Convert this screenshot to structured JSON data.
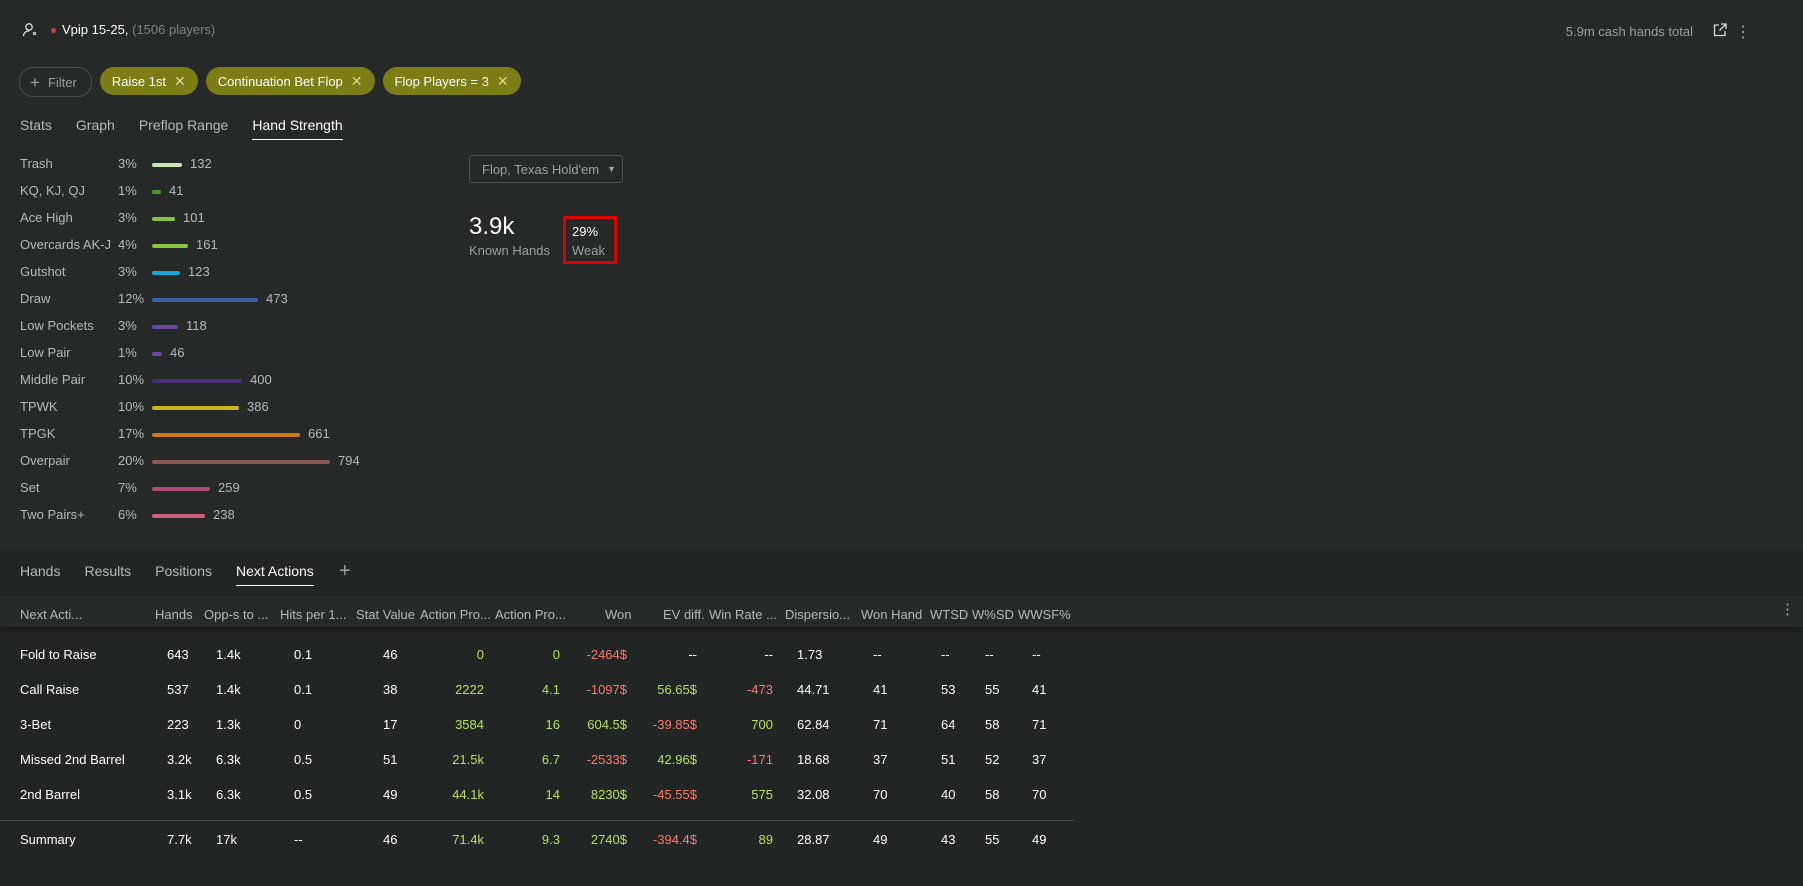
{
  "header": {
    "title": "Vpip 15-25,",
    "subtitle": "(1506 players)",
    "hands_total": "5.9m cash hands total"
  },
  "filters": {
    "add_label": "Filter",
    "chips": [
      "Raise 1st",
      "Continuation Bet Flop",
      "Flop Players = 3"
    ]
  },
  "tabs": [
    "Stats",
    "Graph",
    "Preflop Range",
    "Hand Strength"
  ],
  "active_tab": "Hand Strength",
  "hand_strength": [
    {
      "label": "Trash",
      "pct": "3%",
      "count": "132",
      "value": 132,
      "color": "#c8e6b4"
    },
    {
      "label": "KQ, KJ, QJ",
      "pct": "1%",
      "count": "41",
      "value": 41,
      "color": "#4b9a2a"
    },
    {
      "label": "Ace High",
      "pct": "3%",
      "count": "101",
      "value": 101,
      "color": "#8ac43c"
    },
    {
      "label": "Overcards AK-J",
      "pct": "4%",
      "count": "161",
      "value": 161,
      "color": "#8ac43c"
    },
    {
      "label": "Gutshot",
      "pct": "3%",
      "count": "123",
      "value": 123,
      "color": "#1aa7d8"
    },
    {
      "label": "Draw",
      "pct": "12%",
      "count": "473",
      "value": 473,
      "color": "#3c5ea8"
    },
    {
      "label": "Low Pockets",
      "pct": "3%",
      "count": "118",
      "value": 118,
      "color": "#6a4aa0"
    },
    {
      "label": "Low Pair",
      "pct": "1%",
      "count": "46",
      "value": 46,
      "color": "#6a4aa0"
    },
    {
      "label": "Middle Pair",
      "pct": "10%",
      "count": "400",
      "value": 400,
      "color": "#4a2f7a"
    },
    {
      "label": "TPWK",
      "pct": "10%",
      "count": "386",
      "value": 386,
      "color": "#c8b81e"
    },
    {
      "label": "TPGK",
      "pct": "17%",
      "count": "661",
      "value": 661,
      "color": "#d07a18"
    },
    {
      "label": "Overpair",
      "pct": "20%",
      "count": "794",
      "value": 794,
      "color": "#8a5a55"
    },
    {
      "label": "Set",
      "pct": "7%",
      "count": "259",
      "value": 259,
      "color": "#b04a78"
    },
    {
      "label": "Two Pairs+",
      "pct": "6%",
      "count": "238",
      "value": 238,
      "color": "#d0607a"
    }
  ],
  "street_select": "Flop, Texas Hold'em",
  "known_hands": {
    "value": "3.9k",
    "label": "Known Hands"
  },
  "weak": {
    "value": "29%",
    "label": "Weak"
  },
  "bottom_tabs": [
    "Hands",
    "Results",
    "Positions",
    "Next Actions"
  ],
  "bottom_active": "Next Actions",
  "table": {
    "headers": [
      "Next Acti...",
      "Hands",
      "Opp-s to ...",
      "Hits per 1...",
      "Stat Value",
      "Action Pro...",
      "Action Pro...",
      "Won",
      "EV diff.",
      "Win Rate ...",
      "Dispersio...",
      "Won Hand",
      "WTSD",
      "W%SD",
      "WWSF%"
    ],
    "rows": [
      [
        "Fold to Raise",
        "643",
        "1.4k",
        "0.1",
        "46",
        "0",
        "0",
        "-2464$",
        "--",
        "--",
        "1.73",
        "--",
        "--",
        "--",
        "--"
      ],
      [
        "Call Raise",
        "537",
        "1.4k",
        "0.1",
        "38",
        "2222",
        "4.1",
        "-1097$",
        "56.65$",
        "-473",
        "44.71",
        "41",
        "53",
        "55",
        "41"
      ],
      [
        "3-Bet",
        "223",
        "1.3k",
        "0",
        "17",
        "3584",
        "16",
        "604.5$",
        "-39.85$",
        "700",
        "62.84",
        "71",
        "64",
        "58",
        "71"
      ],
      [
        "Missed 2nd Barrel",
        "3.2k",
        "6.3k",
        "0.5",
        "51",
        "21.5k",
        "6.7",
        "-2533$",
        "42.96$",
        "-171",
        "18.68",
        "37",
        "51",
        "52",
        "37"
      ],
      [
        "2nd Barrel",
        "3.1k",
        "6.3k",
        "0.5",
        "49",
        "44.1k",
        "14",
        "8230$",
        "-45.55$",
        "575",
        "32.08",
        "70",
        "40",
        "58",
        "70"
      ]
    ],
    "summary": [
      "Summary",
      "7.7k",
      "17k",
      "--",
      "46",
      "71.4k",
      "9.3",
      "2740$",
      "-394.4$",
      "89",
      "28.87",
      "49",
      "43",
      "55",
      "49"
    ]
  }
}
